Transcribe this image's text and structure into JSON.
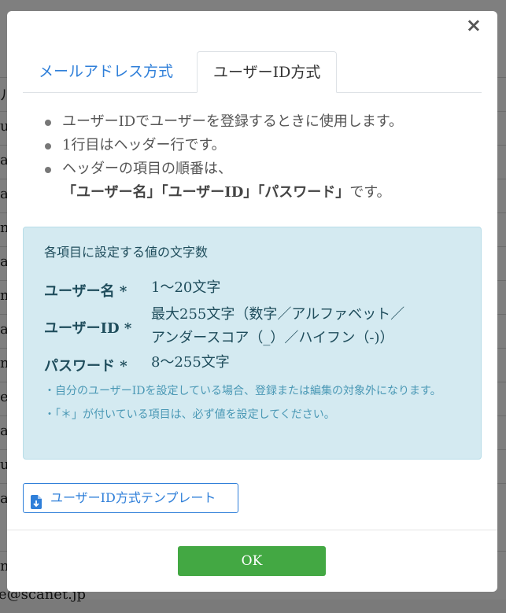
{
  "background": {
    "rows": [
      {
        "frag": "ル"
      },
      {
        "frag": "ul"
      },
      {
        "frag": "a"
      },
      {
        "frag": "a"
      },
      {
        "frag": "n-"
      },
      {
        "frag": "a"
      },
      {
        "frag": "m"
      },
      {
        "frag": "a"
      },
      {
        "frag": "ni"
      },
      {
        "frag": "e"
      },
      {
        "frag": "a"
      },
      {
        "frag": "ul"
      },
      {
        "frag": "a"
      },
      {
        "frag": "no"
      }
    ],
    "bottom_text": "e@scanet.jp"
  },
  "modal": {
    "close_label": "×",
    "tabs": {
      "email": "メールアドレス方式",
      "userid": "ユーザーID方式"
    },
    "bullets": {
      "b1": "ユーザーIDでユーザーを登録するときに使用します。",
      "b2": "1行目はヘッダー行です。",
      "b3_line1": "ヘッダーの項目の順番は、",
      "b3_q1": "「ユーザー名」「ユーザーID」「パスワード」",
      "b3_tail": "です。"
    },
    "info": {
      "title": "各項目に設定する値の文字数",
      "username_label": "ユーザー名 *",
      "username_value": "1〜20文字",
      "userid_label": "ユーザーID *",
      "userid_value_line1": "最大255文字（数字／アルファベット／",
      "userid_value_line2": "アンダースコア（_）／ハイフン（-)）",
      "password_label": "パスワード *",
      "password_value": "8〜255文字",
      "note1": "・自分のユーザーIDを設定している場合、登録または編集の対象外になります。",
      "note2": "・「＊」が付いている項目は、必ず値を設定してください。"
    },
    "template_button": "ユーザーID方式テンプレート",
    "ok_button": "OK"
  },
  "colors": {
    "link_blue": "#2f7fd9",
    "ok_green": "#43a843",
    "info_bg": "#d4eaf1"
  }
}
